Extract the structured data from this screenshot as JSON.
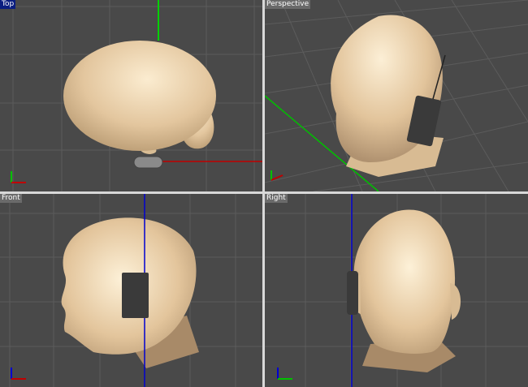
{
  "viewports": [
    {
      "label": "Top",
      "active": true
    },
    {
      "label": "Perspective",
      "active": false
    },
    {
      "label": "Front",
      "active": false
    },
    {
      "label": "Right",
      "active": false
    }
  ],
  "colors": {
    "background": "#494949",
    "grid": "#5c5c5c",
    "skin": "#e8cfa8",
    "device": "#3a3a3a",
    "x_axis": "#c00000",
    "y_axis": "#00c000",
    "z_axis": "#0000d0",
    "active_label": "#0a1d80"
  }
}
